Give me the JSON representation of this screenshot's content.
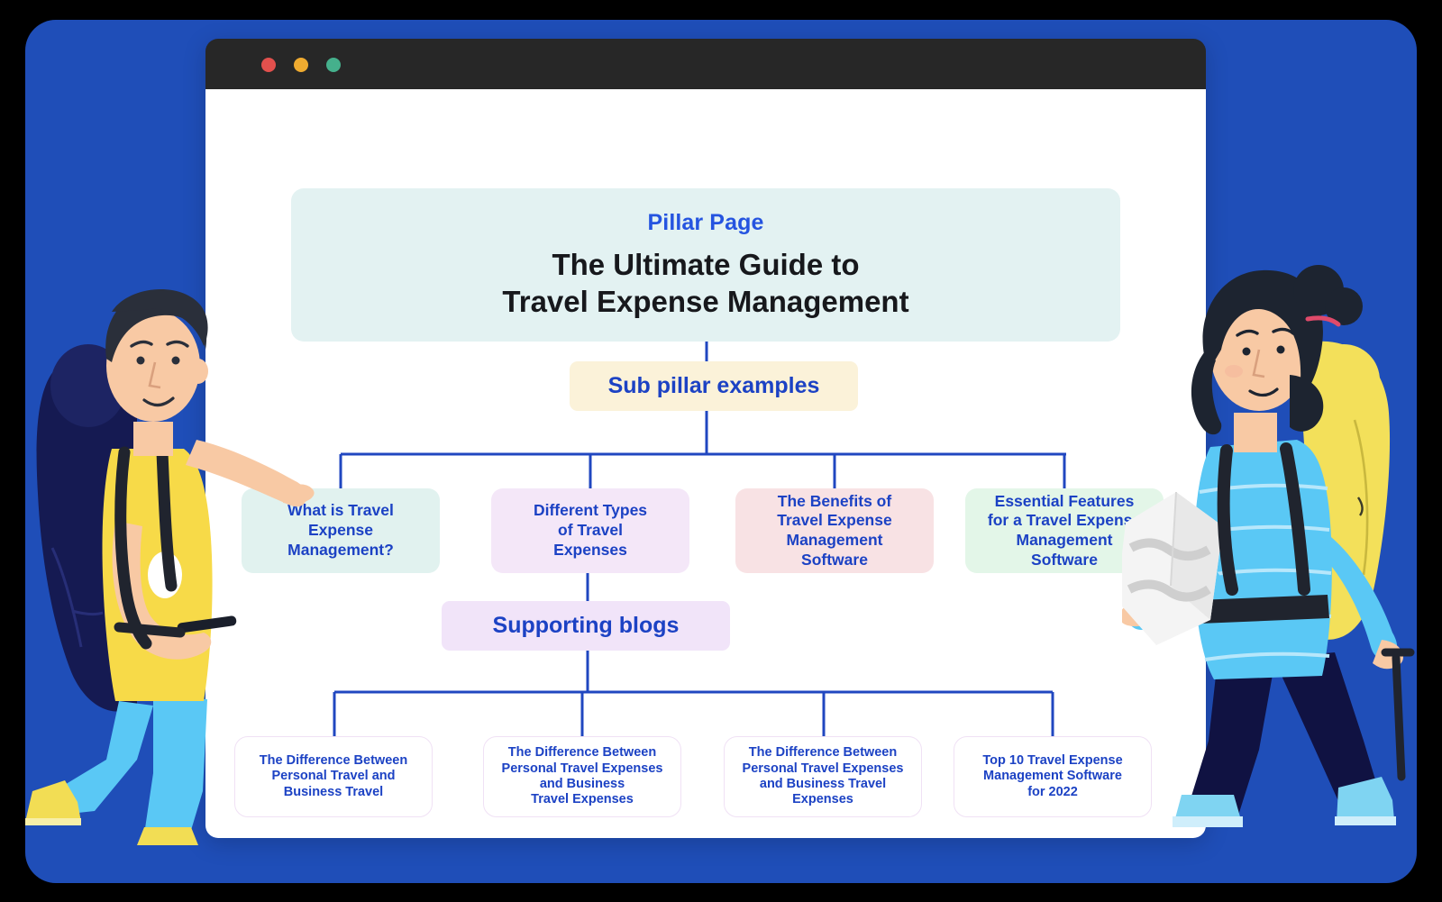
{
  "theme": {
    "panel_bg": "#1f4eb8",
    "page_bg": "#000000",
    "browser_chrome": "#272727",
    "content_bg": "#ffffff",
    "accent_blue": "#1c42c4",
    "eyebrow_blue": "#2554e0",
    "connector_blue": "#2047c0"
  },
  "browser": {
    "traffic_lights": [
      {
        "name": "close-dot",
        "color": "#e2504d"
      },
      {
        "name": "minimize-dot",
        "color": "#efab30"
      },
      {
        "name": "maximize-dot",
        "color": "#45b08c"
      }
    ],
    "address_bar_value": "",
    "address_bar_placeholder": ""
  },
  "diagram": {
    "type": "content-pillar-cluster-tree",
    "pillar": {
      "eyebrow": "Pillar Page",
      "title": "The Ultimate Guide to\nTravel Expense Management",
      "bg": "#e3f2f2"
    },
    "sub_pillar_label": {
      "text": "Sub pillar examples",
      "bg": "#fbf2d9"
    },
    "sub_pillars": [
      {
        "text": "What is Travel\nExpense\nManagement?",
        "bg": "#e1f2ef"
      },
      {
        "text": "Different Types\nof Travel\nExpenses",
        "bg": "#f4e7f8"
      },
      {
        "text": "The Benefits of\nTravel Expense\nManagement\nSoftware",
        "bg": "#f8e2e4"
      },
      {
        "text": "Essential Features\nfor a Travel Expense\nManagement\nSoftware",
        "bg": "#e3f6e8"
      }
    ],
    "supporting_label": {
      "text": "Supporting blogs",
      "bg": "#f1e4f9"
    },
    "supporting_blogs": [
      {
        "text": "The Difference Between\nPersonal Travel and\nBusiness Travel"
      },
      {
        "text": "The Difference Between\nPersonal Travel Expenses\nand Business\nTravel Expenses"
      },
      {
        "text": "The Difference Between\nPersonal Travel Expenses\nand Business Travel\nExpenses"
      },
      {
        "text": "Top 10 Travel Expense\nManagement Software\nfor 2022"
      }
    ]
  },
  "illustrations": {
    "left": {
      "name": "man-pointing-with-backpack",
      "shirt": "#f7da48",
      "pants": "#5ac8f5",
      "shoes": "#f2dd54",
      "backpack": "#151a52",
      "hair": "#2a2f3a",
      "skin": "#f8c9a4"
    },
    "right": {
      "name": "woman-with-map-and-backpack",
      "shirt": "#5ac8f5",
      "pants": "#101242",
      "shoes": "#7fd4f2",
      "backpack": "#f3e05a",
      "hair": "#1d2430",
      "skin": "#f8c9a4",
      "map": "#f2f2f2"
    }
  }
}
